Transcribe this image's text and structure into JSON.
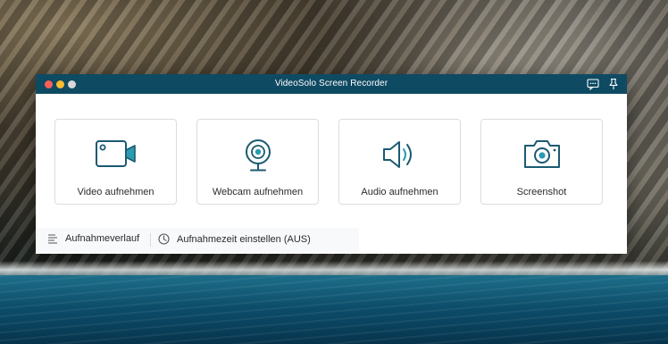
{
  "window": {
    "title": "VideoSolo Screen Recorder",
    "titlebar_color": "#0f4a63",
    "accent_color": "#1b5a72"
  },
  "titlebar_icons": [
    "chat-icon",
    "pin-icon"
  ],
  "cards": [
    {
      "label": "Video aufnehmen",
      "icon": "video-camera-icon"
    },
    {
      "label": "Webcam aufnehmen",
      "icon": "webcam-icon"
    },
    {
      "label": "Audio aufnehmen",
      "icon": "speaker-icon"
    },
    {
      "label": "Screenshot",
      "icon": "photo-camera-icon"
    }
  ],
  "footer": {
    "history_label": "Aufnahmeverlauf",
    "history_icon": "list-icon",
    "timer_label": "Aufnahmezeit einstellen (AUS)",
    "timer_icon": "clock-icon"
  }
}
